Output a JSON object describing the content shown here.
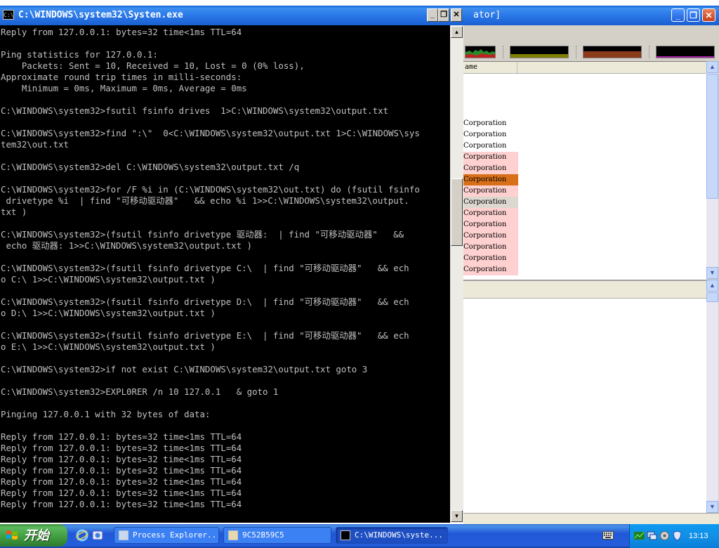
{
  "process_explorer": {
    "title_partial": "ator]",
    "list_header": "ame",
    "rows": [
      "Corporation",
      "Corporation",
      "Corporation",
      "Corporation",
      "Corporation",
      "Corporation",
      "Corporation",
      "Corporation",
      "Corporation",
      "Corporation",
      "Corporation",
      "Corporation",
      "Corporation",
      "Corporation"
    ],
    "row_colors": [
      "#ffffff",
      "#ffffff",
      "#ffffff",
      "#ffd0d0",
      "#ffd0d0",
      "#d8701a",
      "#ffd0d0",
      "#dcd8d0",
      "#ffd0d0",
      "#ffd0d0",
      "#ffd0d0",
      "#ffd0d0",
      "#ffd0d0",
      "#ffd0d0"
    ]
  },
  "console": {
    "title": "C:\\WINDOWS\\system32\\Systen.exe",
    "title_icon": "C:\\",
    "minimize_label": "_",
    "restore_label": "❐",
    "close_label": "✕",
    "lines": [
      "Reply from 127.0.0.1: bytes=32 time<1ms TTL=64",
      "",
      "Ping statistics for 127.0.0.1:",
      "    Packets: Sent = 10, Received = 10, Lost = 0 (0% loss),",
      "Approximate round trip times in milli-seconds:",
      "    Minimum = 0ms, Maximum = 0ms, Average = 0ms",
      "",
      "C:\\WINDOWS\\system32>fsutil fsinfo drives  1>C:\\WINDOWS\\system32\\output.txt",
      "",
      "C:\\WINDOWS\\system32>find \":\\\"  0<C:\\WINDOWS\\system32\\output.txt 1>C:\\WINDOWS\\sys",
      "tem32\\out.txt",
      "",
      "C:\\WINDOWS\\system32>del C:\\WINDOWS\\system32\\output.txt /q",
      "",
      "C:\\WINDOWS\\system32>for /F %i in (C:\\WINDOWS\\system32\\out.txt) do (fsutil fsinfo",
      " drivetype %i  | find \"可移动驱动器\"   && echo %i 1>>C:\\WINDOWS\\system32\\output.",
      "txt )",
      "",
      "C:\\WINDOWS\\system32>(fsutil fsinfo drivetype 驱动器:  | find \"可移动驱动器\"   &&",
      " echo 驱动器: 1>>C:\\WINDOWS\\system32\\output.txt )",
      "",
      "C:\\WINDOWS\\system32>(fsutil fsinfo drivetype C:\\  | find \"可移动驱动器\"   && ech",
      "o C:\\ 1>>C:\\WINDOWS\\system32\\output.txt )",
      "",
      "C:\\WINDOWS\\system32>(fsutil fsinfo drivetype D:\\  | find \"可移动驱动器\"   && ech",
      "o D:\\ 1>>C:\\WINDOWS\\system32\\output.txt )",
      "",
      "C:\\WINDOWS\\system32>(fsutil fsinfo drivetype E:\\  | find \"可移动驱动器\"   && ech",
      "o E:\\ 1>>C:\\WINDOWS\\system32\\output.txt )",
      "",
      "C:\\WINDOWS\\system32>if not exist C:\\WINDOWS\\system32\\output.txt goto 3",
      "",
      "C:\\WINDOWS\\system32>EXPL0RER /n 10 127.0.1   & goto 1",
      "",
      "Pinging 127.0.0.1 with 32 bytes of data:",
      "",
      "Reply from 127.0.0.1: bytes=32 time<1ms TTL=64",
      "Reply from 127.0.0.1: bytes=32 time<1ms TTL=64",
      "Reply from 127.0.0.1: bytes=32 time<1ms TTL=64",
      "Reply from 127.0.0.1: bytes=32 time<1ms TTL=64",
      "Reply from 127.0.0.1: bytes=32 time<1ms TTL=64",
      "Reply from 127.0.0.1: bytes=32 time<1ms TTL=64",
      "Reply from 127.0.0.1: bytes=32 time<1ms TTL=64"
    ]
  },
  "taskbar": {
    "start_label": "开始",
    "quick_launch": [
      "ie-icon",
      "explorer-icon"
    ],
    "tasks": [
      {
        "label": "Process Explorer...",
        "icon": "process-explorer-icon",
        "active": false
      },
      {
        "label": "9C52B59C5",
        "icon": "app-icon",
        "active": false
      },
      {
        "label": "C:\\WINDOWS\\syste...",
        "icon": "console-icon",
        "active": true
      }
    ],
    "clock": "13:13",
    "tray_icons": [
      "keyboard-icon",
      "network-icon",
      "volume-icon",
      "security-icon",
      "antivirus-icon"
    ]
  }
}
